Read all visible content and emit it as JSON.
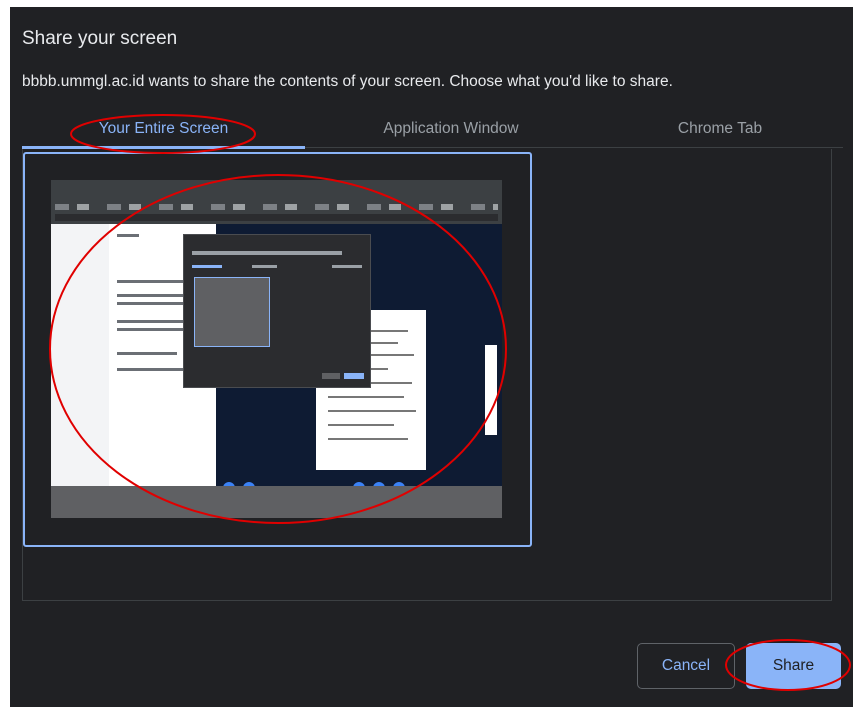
{
  "dialog": {
    "title": "Share your screen",
    "subtitle": "bbbb.ummgl.ac.id wants to share the contents of your screen. Choose what you'd like to share."
  },
  "tabs": [
    {
      "label": "Your Entire Screen",
      "active": true
    },
    {
      "label": "Application Window",
      "active": false
    },
    {
      "label": "Chrome Tab",
      "active": false
    }
  ],
  "buttons": {
    "cancel": "Cancel",
    "share": "Share"
  },
  "colors": {
    "background": "#202124",
    "accent": "#8ab4f8",
    "annotation": "#e00000"
  }
}
